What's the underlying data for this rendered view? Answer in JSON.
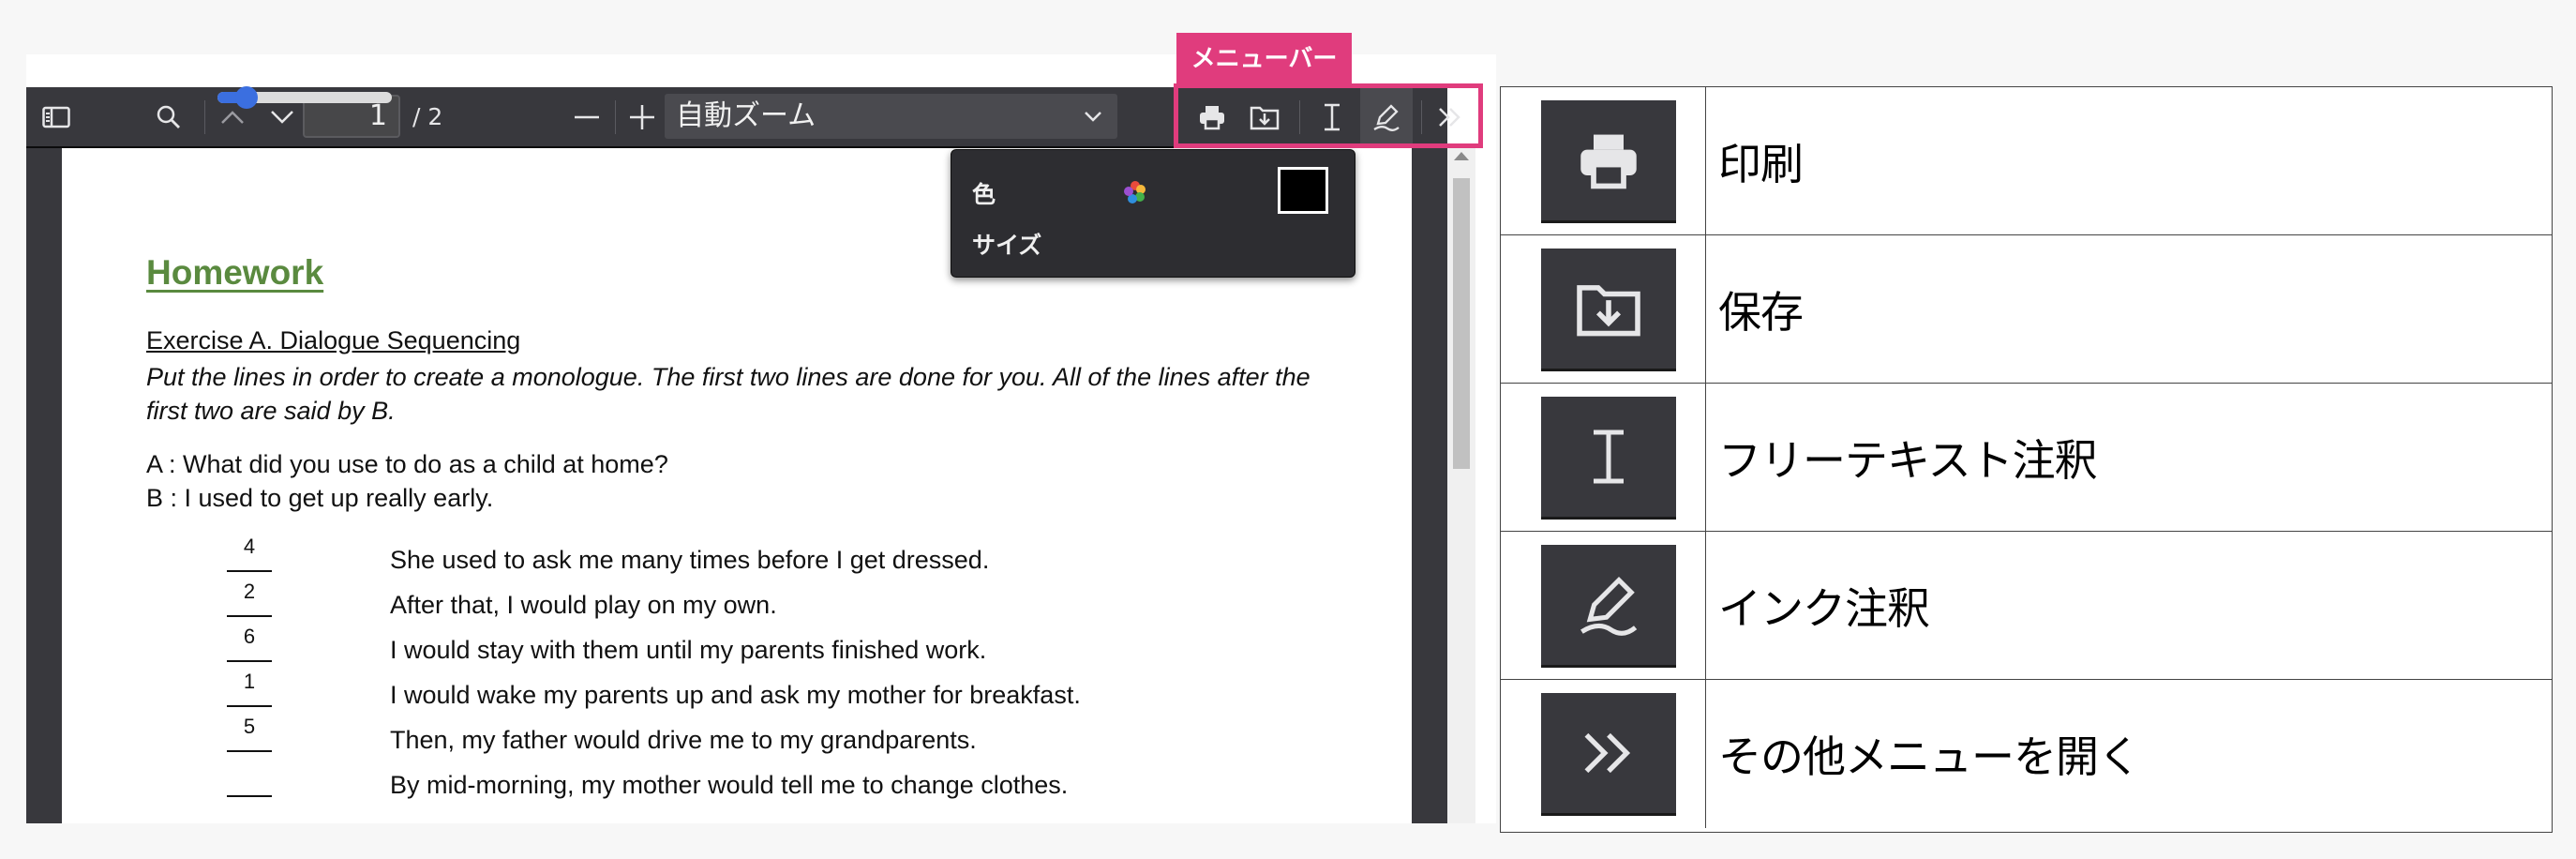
{
  "callout": {
    "menubar_label": "メニューバー"
  },
  "toolbar": {
    "page_number": "1",
    "page_total": "/ 2",
    "zoom_value": "自動ズーム",
    "icons": [
      "sidebar-toggle-icon",
      "search-icon",
      "chevron-up-icon",
      "chevron-down-icon",
      "minus-icon",
      "plus-icon",
      "print-icon",
      "save-icon",
      "text-cursor-icon",
      "pen-icon",
      "double-chevron-right-icon"
    ]
  },
  "ink_popup": {
    "color_label": "色",
    "size_label": "サイズ",
    "color_value": "#000000",
    "size_fraction": 0.1
  },
  "document": {
    "title": "Homework",
    "exercise_heading": "Exercise A. Dialogue Sequencing",
    "instruction": "Put the lines in order to create a monologue. The first two lines are done for you. All of the lines after the first two are said by B.",
    "line_a": "A : What did you use to do as a child at home?",
    "line_b": "B : I used to get up really early.",
    "items": [
      {
        "number": "4",
        "text": "She used to ask me many times before I get dressed."
      },
      {
        "number": "2",
        "text": "After that, I would play on my own."
      },
      {
        "number": "6",
        "text": "I would stay with them until my parents finished work."
      },
      {
        "number": "1",
        "text": "I would wake my parents up and ask my mother for breakfast."
      },
      {
        "number": "5",
        "text": "Then, my father would drive me to my grandparents."
      },
      {
        "number": "",
        "text": "By mid-morning, my mother would tell me to change clothes."
      }
    ]
  },
  "legend": {
    "rows": [
      {
        "icon": "print-icon",
        "label": "印刷"
      },
      {
        "icon": "save-icon",
        "label": "保存"
      },
      {
        "icon": "text-cursor-icon",
        "label": "フリーテキスト注釈"
      },
      {
        "icon": "pen-icon",
        "label": "インク注釈"
      },
      {
        "icon": "double-chevron-right-icon",
        "label": "その他メニューを開く"
      }
    ]
  }
}
